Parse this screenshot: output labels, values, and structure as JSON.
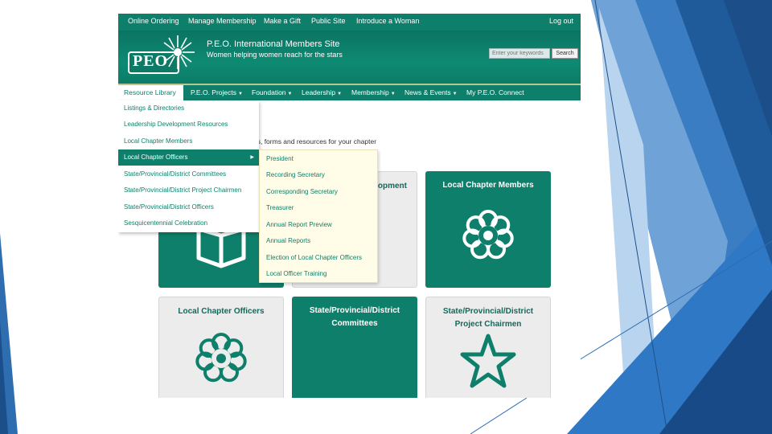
{
  "top_bar": {
    "items": [
      "Online Ordering",
      "Manage Membership",
      "Make a Gift",
      "Public Site",
      "Introduce a Woman"
    ],
    "logout": "Log out"
  },
  "header": {
    "logo_text": "PEO",
    "title": "P.E.O. International Members Site",
    "tagline": "Women helping women reach for the stars",
    "search_placeholder": "Enter your keywords",
    "search_button": "Search"
  },
  "main_nav": {
    "items": [
      "Resource Library",
      "P.E.O. Projects",
      "Foundation",
      "Leadership",
      "Membership",
      "News & Events",
      "My P.E.O. Connect"
    ]
  },
  "intro_text": "gs, forms and resources for your chapter",
  "resource_menu": {
    "items": [
      "Listings & Directories",
      "Leadership Development Resources",
      "Local Chapter Members",
      "Local Chapter Officers",
      "State/Provincial/District Committees",
      "State/Provincial/District Project Chairmen",
      "State/Provincial/District Officers",
      "Sesquicentennial Celebration"
    ],
    "selected": "Local Chapter Officers"
  },
  "officers_submenu": {
    "items": [
      "President",
      "Recording Secretary",
      "Corresponding Secretary",
      "Treasurer",
      "Annual Report Preview",
      "Annual Reports",
      "Election of Local Chapter Officers",
      "Local Officer Training"
    ]
  },
  "tiles": [
    {
      "title": "",
      "style": "green",
      "icon": "book-icon"
    },
    {
      "title": "opment",
      "style": "grey",
      "icon": ""
    },
    {
      "title": "Local Chapter Members",
      "style": "green",
      "icon": "daisy-icon"
    },
    {
      "title": "Local Chapter Officers",
      "style": "grey",
      "icon": "daisy-icon"
    },
    {
      "title": "State/Provincial/District\nCommittees",
      "style": "green",
      "icon": ""
    },
    {
      "title": "State/Provincial/District\nProject Chairmen",
      "style": "grey",
      "icon": "star-icon"
    }
  ],
  "colors": {
    "brand_green": "#0e7f6a",
    "submenu_bg": "#fffde8",
    "tile_grey": "#ececec",
    "deco_blue": "#2f6fb4"
  }
}
